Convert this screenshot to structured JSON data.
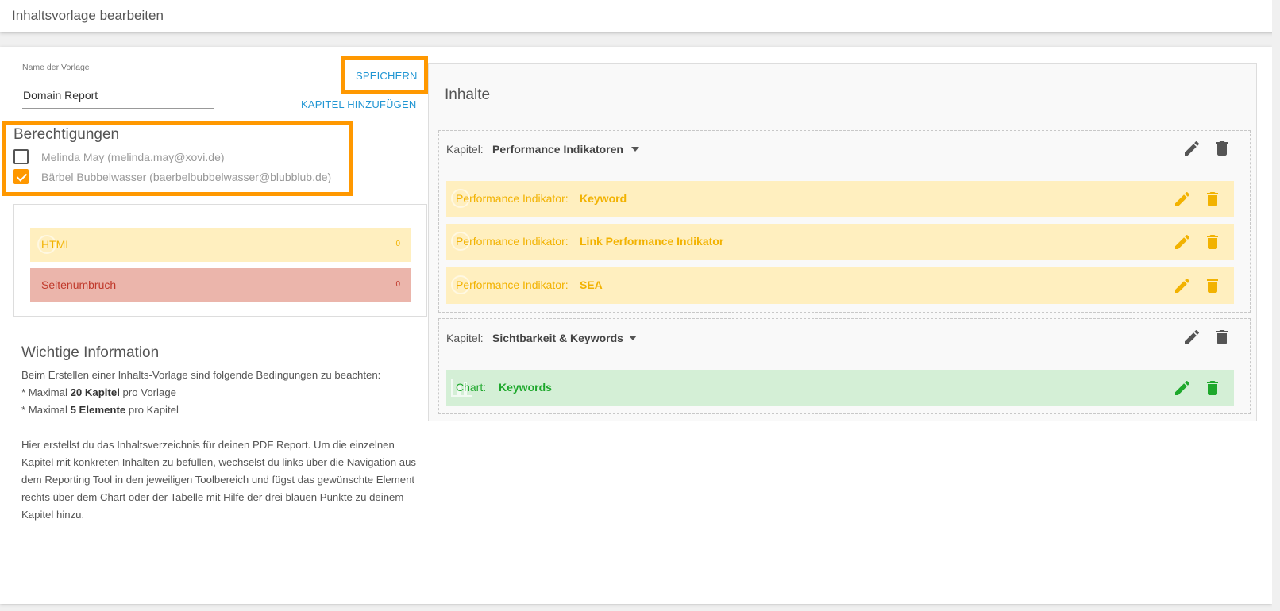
{
  "header": {
    "title": "Inhaltsvorlage bearbeiten"
  },
  "form": {
    "name_label": "Name der Vorlage",
    "name_value": "Domain Report",
    "save_label": "SPEICHERN",
    "add_chapter_label": "KAPITEL HINZUFÜGEN"
  },
  "permissions": {
    "title": "Berechtigungen",
    "users": [
      {
        "label": "Melinda May (melinda.may@xovi.de)",
        "checked": false
      },
      {
        "label": "Bärbel Bubbelwasser (baerbelbubbelwasser@blubblub.de)",
        "checked": true
      }
    ]
  },
  "elements": [
    {
      "name": "HTML",
      "count": "0"
    },
    {
      "name": "Seitenumbruch",
      "count": "0"
    }
  ],
  "info": {
    "title": "Wichtige Information",
    "intro": "Beim Erstellen einer Inhalts-Vorlage sind folgende Bedingungen zu beachten:",
    "rule1_prefix": "* Maximal ",
    "rule1_bold": "20 Kapitel",
    "rule1_suffix": " pro Vorlage",
    "rule2_prefix": "* Maximal ",
    "rule2_bold": "5 Elemente",
    "rule2_suffix": " pro Kapitel",
    "body": "Hier erstellst du das Inhaltsverzeichnis für deinen PDF Report. Um die einzelnen Kapitel mit konkreten Inhalten zu befüllen, wechselst du links über die Navigation aus dem Reporting Tool in den jeweiligen Toolbereich und fügst das gewünschte Element rechts über dem Chart oder der Tabelle mit Hilfe der drei blauen Punkte zu deinem Kapitel hinzu."
  },
  "contents": {
    "title": "Inhalte",
    "chapter_label": "Kapitel:",
    "chapters": [
      {
        "name": "Performance Indikatoren",
        "items": [
          {
            "label": "Performance Indikator:",
            "value": "Keyword"
          },
          {
            "label": "Performance Indikator:",
            "value": "Link Performance Indikator"
          },
          {
            "label": "Performance Indikator:",
            "value": "SEA"
          }
        ]
      },
      {
        "name": "Sichtbarkeit & Keywords",
        "items": [
          {
            "label": "Chart:",
            "value": "Keywords"
          }
        ]
      }
    ]
  },
  "colors": {
    "accent": "#ff9800",
    "link": "#2196d3",
    "item_yellow": "#f2b200",
    "item_green": "#1ea82c",
    "icon_dark": "#555555"
  },
  "icons": {
    "edit": "pencil-icon",
    "delete": "trash-icon",
    "dropdown": "caret-down-icon"
  }
}
